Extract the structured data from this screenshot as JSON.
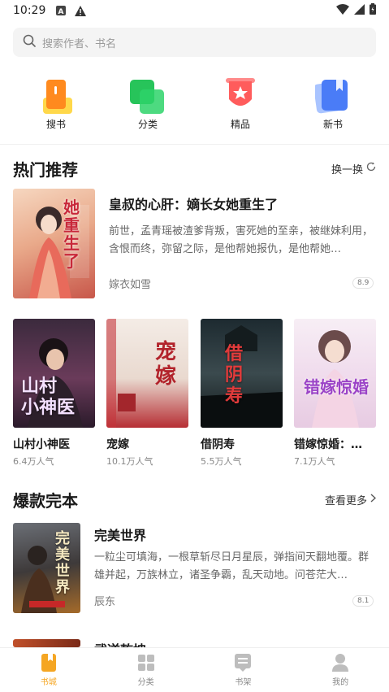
{
  "status_bar": {
    "time": "10:29"
  },
  "search": {
    "placeholder": "搜索作者、书名"
  },
  "quick_nav": [
    {
      "label": "搜书",
      "icon": "search-book-icon",
      "color": "#ff8a1e"
    },
    {
      "label": "分类",
      "icon": "category-icon",
      "color": "#27c45a"
    },
    {
      "label": "精品",
      "icon": "premium-icon",
      "color": "#ff5c5c"
    },
    {
      "label": "新书",
      "icon": "new-book-icon",
      "color": "#4a7cf7"
    }
  ],
  "hot": {
    "title": "热门推荐",
    "refresh_label": "换一换",
    "featured": {
      "title": "皇叔的心肝：嫡长女她重生了",
      "description": "前世，孟青瑶被渣爹背叛，害死她的至亲，被继妹利用，含恨而终，弥留之际，是他帮她报仇，是他帮她…",
      "author": "嫁衣如雪",
      "score": "8.9"
    },
    "books": [
      {
        "name": "山村小神医",
        "popularity": "6.4万人气"
      },
      {
        "name": "宠嫁",
        "popularity": "10.1万人气"
      },
      {
        "name": "借阴寿",
        "popularity": "5.5万人气"
      },
      {
        "name": "错嫁惊婚：…",
        "popularity": "7.1万人气"
      }
    ]
  },
  "complete": {
    "title": "爆款完本",
    "more_label": "查看更多",
    "featured": {
      "title": "完美世界",
      "description": "一粒尘可填海，一根草斩尽日月星辰，弹指间天翻地覆。群雄并起，万族林立，诸圣争霸，乱天动地。问苍茫大…",
      "author": "辰东",
      "score": "8.1"
    },
    "next_title": "武逆乾坤"
  },
  "tabbar": [
    {
      "label": "书城",
      "icon": "bookstore-icon",
      "active": true
    },
    {
      "label": "分类",
      "icon": "grid-icon",
      "active": false
    },
    {
      "label": "书架",
      "icon": "bookshelf-icon",
      "active": false
    },
    {
      "label": "我的",
      "icon": "profile-icon",
      "active": false
    }
  ],
  "colors": {
    "accent": "#f5a623",
    "text_primary": "#1a1a1a",
    "text_secondary": "#666666"
  }
}
